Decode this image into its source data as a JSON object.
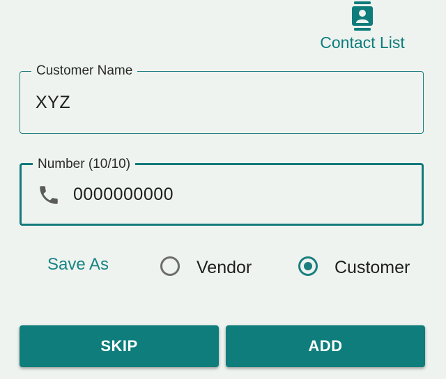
{
  "contact_list": {
    "label": "Contact List",
    "icon": "contact-list-icon"
  },
  "customer_name": {
    "label": "Customer Name",
    "value": "XYZ"
  },
  "number": {
    "label": "Number (10/10)",
    "value": "0000000000",
    "icon": "phone-icon"
  },
  "save_as": {
    "label": "Save As",
    "options": [
      {
        "label": "Vendor",
        "selected": false
      },
      {
        "label": "Customer",
        "selected": true
      }
    ]
  },
  "buttons": {
    "skip_label": "SKIP",
    "add_label": "ADD"
  },
  "colors": {
    "accent": "#0e7d7c",
    "background": "#eef3ef"
  }
}
